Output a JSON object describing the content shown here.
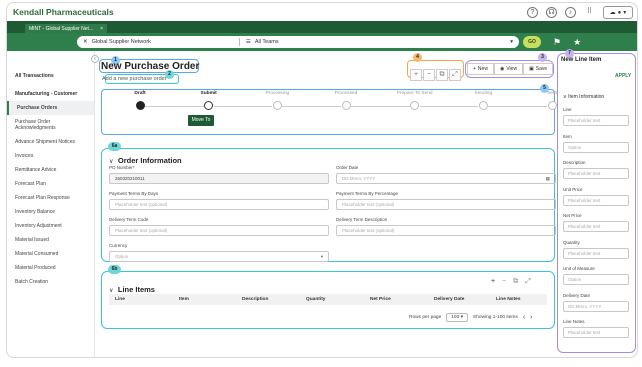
{
  "app": {
    "company": "Kendall Pharmaceuticals"
  },
  "tab": {
    "title": "MINT - Global Supplier Net...",
    "close": "×"
  },
  "search": {
    "network": "Global Supplier Network",
    "teams": "All Teams",
    "go": "GO"
  },
  "sidebar": {
    "items": [
      {
        "label": "All Transactions",
        "type": "head"
      },
      {
        "label": "Manufacturing - Customer",
        "type": "head"
      },
      {
        "label": "Purchase Orders",
        "type": "active"
      },
      {
        "label": "Purchase Order Acknowledgments",
        "type": "item"
      },
      {
        "label": "Advance Shipment Notices",
        "type": "item"
      },
      {
        "label": "Invoices",
        "type": "item"
      },
      {
        "label": "Remittance Advice",
        "type": "item"
      },
      {
        "label": "Forecast Plan",
        "type": "item"
      },
      {
        "label": "Forecast Plan Response",
        "type": "item"
      },
      {
        "label": "Inventory Balance",
        "type": "item"
      },
      {
        "label": "Inventory Adjustment",
        "type": "item"
      },
      {
        "label": "Material Issued",
        "type": "item"
      },
      {
        "label": "Material Consumed",
        "type": "item"
      },
      {
        "label": "Material Produced",
        "type": "item"
      },
      {
        "label": "Batch Creation",
        "type": "item"
      }
    ]
  },
  "page": {
    "title": "New Purchase Order",
    "subtitle": "Add a new purchase order"
  },
  "badges": {
    "b1": "1",
    "b2": "2",
    "b3": "3",
    "b4": "4",
    "b5": "5",
    "b6a": "6a",
    "b6b": "6b",
    "b7": "7"
  },
  "actions": {
    "new": "New",
    "view": "View",
    "save": "Save"
  },
  "steps": [
    {
      "label": "Draft",
      "state": "done"
    },
    {
      "label": "Submit",
      "state": "current"
    },
    {
      "label": "Processing",
      "state": "todo"
    },
    {
      "label": "Processed",
      "state": "todo"
    },
    {
      "label": "Prepare To Send",
      "state": "todo"
    },
    {
      "label": "Sending",
      "state": "todo"
    },
    {
      "label": "Sent",
      "state": "todo"
    }
  ],
  "move_to": "Move To",
  "order_info": {
    "title": "Order Information",
    "po_label": "PO Number*",
    "po_value": "260320210011",
    "order_date_label": "Order Date",
    "order_date_placeholder": "DD Mmm, YYYY",
    "terms_days_label": "Payment Terms By Days",
    "terms_days_placeholder": "Placeholder text (optional)",
    "terms_pct_label": "Payment Terms By Percentage",
    "terms_pct_placeholder": "Placeholder text (optional)",
    "delivery_code_label": "Delivery Term Code",
    "delivery_code_placeholder": "Placeholder text (optional)",
    "delivery_desc_label": "Delivery Term Description",
    "delivery_desc_placeholder": "Placeholder text (optional)",
    "currency_label": "Currency",
    "currency_placeholder": "Option"
  },
  "line_items": {
    "title": "Line Items",
    "columns": [
      "Line",
      "Item",
      "Description",
      "Quantity",
      "Net Price",
      "Delivery Date",
      "Line Notes"
    ],
    "rows_per_page_label": "Rows per page",
    "rows_per_page": "100",
    "showing": "Showing 1-100 items"
  },
  "right_panel": {
    "title": "New Line Item",
    "apply": "APPLY",
    "section": "Item Information",
    "fields": [
      {
        "label": "Line",
        "placeholder": "Placeholder text"
      },
      {
        "label": "Item",
        "placeholder": "Option"
      },
      {
        "label": "Description",
        "placeholder": "Placeholder text"
      },
      {
        "label": "Unit Price",
        "placeholder": "Placeholder text"
      },
      {
        "label": "Net Price",
        "placeholder": "Placeholder text"
      },
      {
        "label": "Quantity",
        "placeholder": "Placeholder text"
      },
      {
        "label": "Unit of Measure",
        "placeholder": "Option"
      },
      {
        "label": "Delivery Date",
        "placeholder": "DD Mmm, YYYY"
      },
      {
        "label": "Line Notes",
        "placeholder": "Placeholder text"
      }
    ]
  },
  "colors": {
    "brand_dark": "#1e5b35",
    "brand": "#2e7f4c",
    "go": "#c8df5e"
  }
}
